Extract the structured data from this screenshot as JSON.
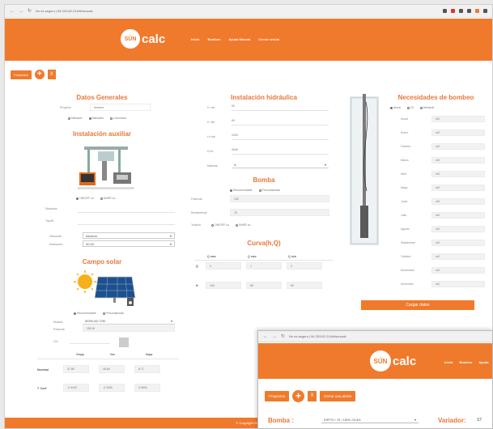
{
  "browser": {
    "url": "No es seguro | 94.203.82.214/#/suncalc",
    "url2": "No es seguro | 94.203.82.214/#/suncalc"
  },
  "brand": {
    "logo_circle": "SÚN",
    "logo_text": "calc",
    "color": "#f07a2b"
  },
  "menu": [
    "Inicio",
    "Bombeo",
    "Ayuda Manual",
    "Cerrar sesión"
  ],
  "menu2": [
    "Inicio",
    "Bombeo",
    "Ayuda"
  ],
  "toolbar": {
    "proyectos": "Proyectos",
    "add": "+",
    "doc": "X"
  },
  "toolbar2": {
    "proyectos": "Proyectos",
    "add": "+",
    "doc": "X",
    "alerta": "Cerrar una alerta"
  },
  "datos_generales": {
    "title": "Datos Generales",
    "proyecto_label": "Proyecto",
    "proyecto_value": "Nombre",
    "radios": [
      "Hidráulic",
      "Manualm",
      "Loturobad"
    ]
  },
  "instalacion_auxiliar": {
    "title": "Instalación auxiliar",
    "radios": [
      "ON/OFF cu",
      "SinRE cu"
    ],
    "fields": [
      "Distancia",
      "Tipo/N"
    ],
    "ubicacion_label": "Ubicación",
    "ubicacion_value": "Almería",
    "inclinacion_label": "Inclinación",
    "inclinacion_value": "30.00"
  },
  "campo_solar": {
    "title": "Campo solar",
    "radios": [
      "Recomendable",
      "Personalizada"
    ],
    "modelo_label": "Modelo",
    "modelo_value": "M250-60-72M",
    "potencia_label": "Potencia",
    "potencia_value": "250 W",
    "cant_label": "Cnt",
    "columns": [
      "Vmpp",
      "Voc",
      "Impp"
    ],
    "rows": [
      {
        "label": "Nominal",
        "values": [
          "37.86",
          "46.84",
          "8.71"
        ]
      },
      {
        "label": "T. Coef",
        "values": [
          "-0.4100",
          "-0.3300",
          "0.0600"
        ]
      }
    ]
  },
  "instalacion_hidraulica": {
    "title": "Instalación hidráulica",
    "fields": [
      {
        "label": "H. est.",
        "value": "50"
      },
      {
        "label": "H. din.",
        "value": "60"
      },
      {
        "label": "Ln tub.",
        "value": "1000"
      },
      {
        "label": "D.int.",
        "value": "40x8"
      }
    ],
    "material_label": "Material",
    "material_value": "A"
  },
  "bomba": {
    "title": "Bomba",
    "radios": [
      "Recomendable",
      "Personalizada"
    ],
    "potencia_label": "Potencia",
    "potencia_value": "230",
    "rendimiento_label": "Rendimiento",
    "rendimiento_value": "76",
    "tension_label": "Tensión",
    "tension_radios": [
      "ON/OFF cu",
      "SinRE cu"
    ]
  },
  "curva": {
    "title": "Curva(h,Q)",
    "columns": [
      "Q max",
      "Q max",
      "Q min"
    ],
    "rows": [
      {
        "label": "Q",
        "values": [
          "0",
          "1",
          "2"
        ]
      },
      {
        "label": "H",
        "values": [
          "100",
          "80",
          "50"
        ]
      }
    ]
  },
  "necesidades": {
    "title": "Necesidades de bombeo",
    "radios": [
      "Anual",
      "10",
      "Mensual"
    ],
    "months": [
      "Anual",
      "Enero",
      "Febrero",
      "Marzo",
      "Abril",
      "Mayo",
      "Junio",
      "Julio",
      "Agosto",
      "Septiembre",
      "Octubre",
      "Noviembre",
      "Diciembre"
    ],
    "value": "m3",
    "button": "Cargar datos"
  },
  "footer": {
    "text": "© Copyright 2019"
  },
  "second_window": {
    "bomba_label": "Bomba :",
    "bomba_value": "ESP70 / 70 / 15HC-S13/4",
    "variador_label": "Variador:",
    "variador_value": "ST"
  }
}
